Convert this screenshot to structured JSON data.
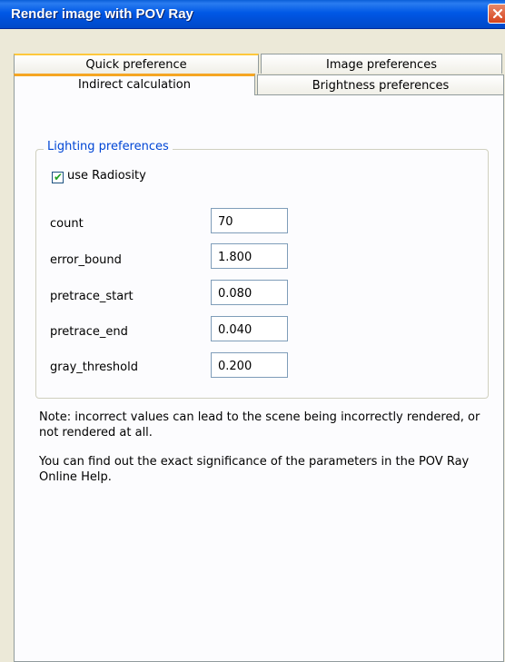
{
  "window": {
    "title": "Render image with POV Ray"
  },
  "tabs": {
    "quick": "Quick preference",
    "image": "Image preferences",
    "indirect": "Indirect calculation",
    "brightness": "Brightness preferences"
  },
  "group": {
    "title": "Lighting preferences",
    "use_radiosity_label": "use Radiosity",
    "use_radiosity_checked": true
  },
  "params": [
    {
      "label": "count",
      "value": "70"
    },
    {
      "label": "error_bound",
      "value": "1.800"
    },
    {
      "label": "pretrace_start",
      "value": "0.080"
    },
    {
      "label": "pretrace_end",
      "value": "0.040"
    },
    {
      "label": "gray_threshold",
      "value": "0.200"
    }
  ],
  "notes": [
    "Note: incorrect values can lead to the scene being incorrectly rendered, or not rendered at all.",
    "You can find out the exact significance of the parameters in the POV Ray Online Help."
  ],
  "colors": {
    "title_bar": "#0058e6",
    "active_tab_accent": "#f5a623",
    "group_label": "#0046d5",
    "dialog_bg": "#ece9d8"
  }
}
